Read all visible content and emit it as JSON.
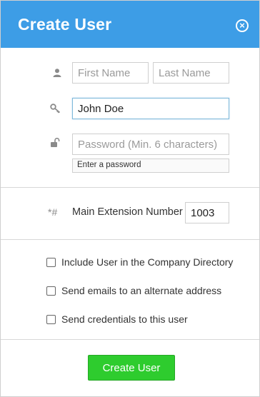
{
  "dialog": {
    "title": "Create User",
    "close_label": "×"
  },
  "form": {
    "first_name": {
      "value": "",
      "placeholder": "First Name"
    },
    "last_name": {
      "value": "",
      "placeholder": "Last Name"
    },
    "username": {
      "value": "John Doe",
      "placeholder": ""
    },
    "password": {
      "value": "",
      "placeholder": "Password (Min. 6 characters)"
    },
    "password_hint": "Enter a password",
    "extension_icon": "*#",
    "extension_label": "Main Extension Number",
    "extension_value": "1003"
  },
  "options": {
    "include_directory": {
      "label": "Include User in the Company Directory",
      "checked": false
    },
    "alternate_email": {
      "label": "Send emails to an alternate address",
      "checked": false
    },
    "send_credentials": {
      "label": "Send credentials to this user",
      "checked": false
    }
  },
  "actions": {
    "create_label": "Create User"
  },
  "colors": {
    "header": "#3d9de6",
    "create_button": "#2ecc2e"
  }
}
